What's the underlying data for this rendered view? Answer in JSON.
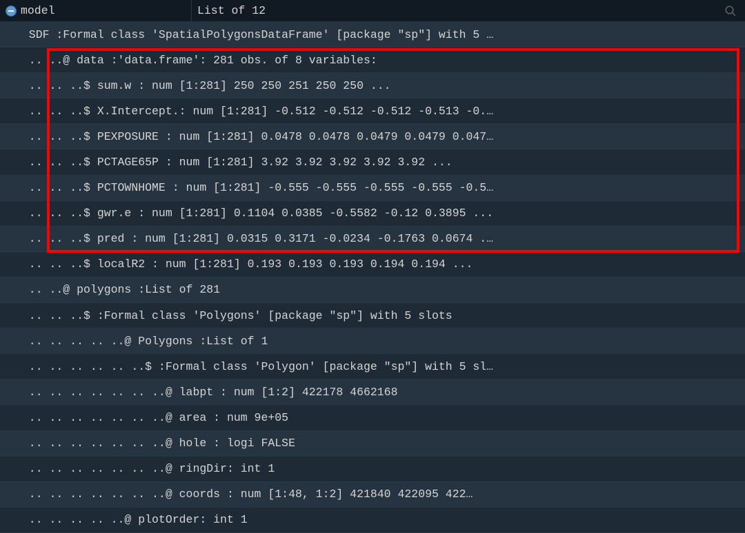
{
  "header": {
    "var_name": "model",
    "summary": "List of 12"
  },
  "rows": [
    "  SDF :Formal class 'SpatialPolygonsDataFrame' [package \"sp\"] with 5 …",
    "  .. ..@ data :'data.frame': 281 obs. of 8 variables:",
    "  .. .. ..$ sum.w : num [1:281] 250 250 251 250 250 ...",
    "  .. .. ..$ X.Intercept.: num [1:281] -0.512 -0.512 -0.512 -0.513 -0.…",
    "  .. .. ..$ PEXPOSURE : num [1:281] 0.0478 0.0478 0.0479 0.0479 0.047…",
    "  .. .. ..$ PCTAGE65P : num [1:281] 3.92 3.92 3.92 3.92 3.92 ...",
    "  .. .. ..$ PCTOWNHOME : num [1:281] -0.555 -0.555 -0.555 -0.555 -0.5…",
    "  .. .. ..$ gwr.e : num [1:281] 0.1104 0.0385 -0.5582 -0.12 0.3895 ...",
    "  .. .. ..$ pred : num [1:281] 0.0315 0.3171 -0.0234 -0.1763 0.0674 .…",
    "  .. .. ..$ localR2 : num [1:281] 0.193 0.193 0.193 0.194 0.194 ...",
    "  .. ..@ polygons :List of 281",
    "  .. .. ..$ :Formal class 'Polygons' [package \"sp\"] with 5 slots",
    "  .. .. .. .. ..@ Polygons :List of 1",
    "  .. .. .. .. .. ..$ :Formal class 'Polygon' [package \"sp\"] with 5 sl…",
    "  .. .. .. .. .. .. ..@ labpt : num [1:2] 422178 4662168",
    "  .. .. .. .. .. .. ..@ area : num 9e+05",
    "  .. .. .. .. .. .. ..@ hole : logi FALSE",
    "  .. .. .. .. .. .. ..@ ringDir: int 1",
    "  .. .. .. .. .. .. ..@ coords : num [1:48, 1:2] 421840 422095 422…",
    "  .. .. .. .. ..@ plotOrder: int 1"
  ]
}
